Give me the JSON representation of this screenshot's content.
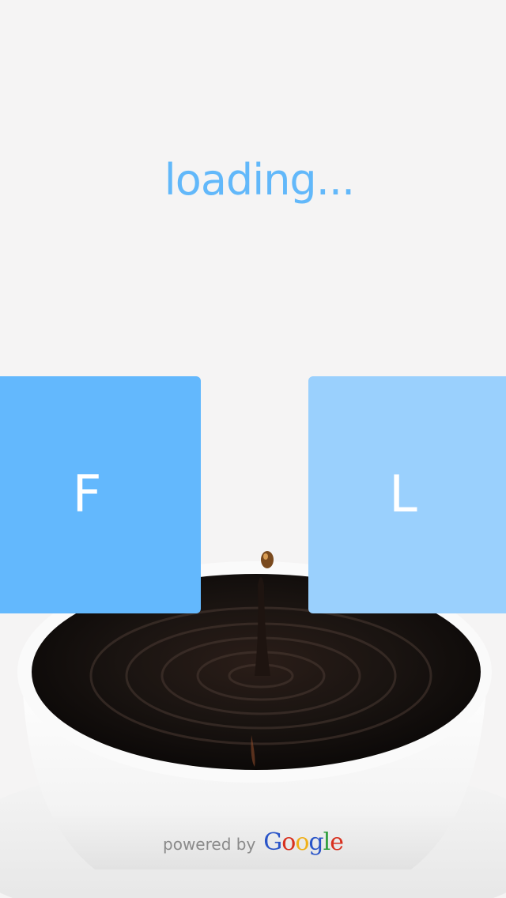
{
  "loading": {
    "text": "loading..."
  },
  "tiles": {
    "left": {
      "label": "F",
      "color": "#63b8fd"
    },
    "right": {
      "label": "L",
      "color": "#9ad0fd"
    }
  },
  "footer": {
    "powered_by": "powered by",
    "logo_text": "Google"
  },
  "colors": {
    "background": "#f5f4f4",
    "accent": "#62b8fa"
  }
}
